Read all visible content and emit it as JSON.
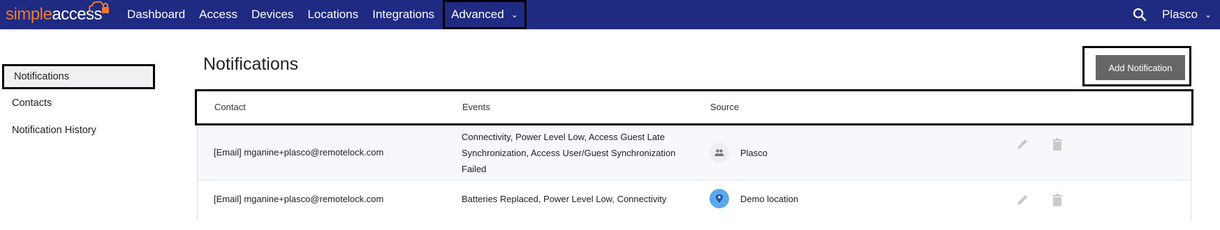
{
  "brand": {
    "part1": "simple",
    "part2": "access"
  },
  "nav": {
    "items": [
      "Dashboard",
      "Access",
      "Devices",
      "Locations",
      "Integrations"
    ],
    "advanced": "Advanced",
    "account": "Plasco"
  },
  "sidebar": {
    "items": [
      "Notifications",
      "Contacts",
      "Notification History"
    ]
  },
  "main": {
    "title": "Notifications",
    "add_button": "Add Notification",
    "columns": [
      "Contact",
      "Events",
      "Source"
    ],
    "rows": [
      {
        "contact": "[Email] mganine+plasco@remotelock.com",
        "events": "Connectivity, Power Level Low, Access Guest Late Synchronization, Access User/Guest Synchronization Failed",
        "source": "Plasco",
        "source_icon": "group-icon"
      },
      {
        "contact": "[Email] mganine+plasco@remotelock.com",
        "events": "Batteries Replaced, Power Level Low, Connectivity",
        "source": "Demo location",
        "source_icon": "location-pin-icon"
      }
    ]
  },
  "colors": {
    "navbar": "#1f2a82",
    "brand_orange": "#f07b2e",
    "button": "#666666",
    "location_badge": "#5aa8ea"
  }
}
